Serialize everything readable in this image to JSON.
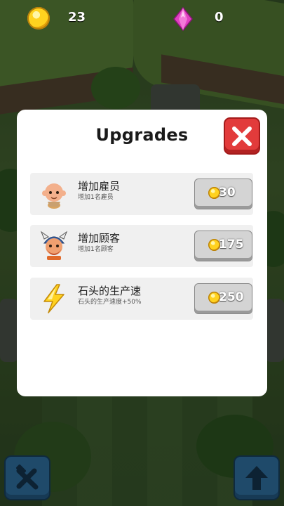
{
  "hud": {
    "coins": "23",
    "gems": "0"
  },
  "modal": {
    "title": "Upgrades",
    "items": [
      {
        "name": "增加雇员",
        "desc": "增加1名雇员",
        "price": "30",
        "icon": "worker-icon"
      },
      {
        "name": "增加顾客",
        "desc": "增加1名顾客",
        "price": "175",
        "icon": "viking-customer-icon"
      },
      {
        "name": "石头的生产速",
        "desc": "石头的生产速度+50%",
        "price": "250",
        "icon": "lightning-icon"
      }
    ]
  },
  "colors": {
    "close_button": "#e23b3b",
    "row_background": "#f0f0f0",
    "buy_button": "#d4d4d4",
    "coin": "#ffd21f",
    "gem": "#e040c0"
  }
}
